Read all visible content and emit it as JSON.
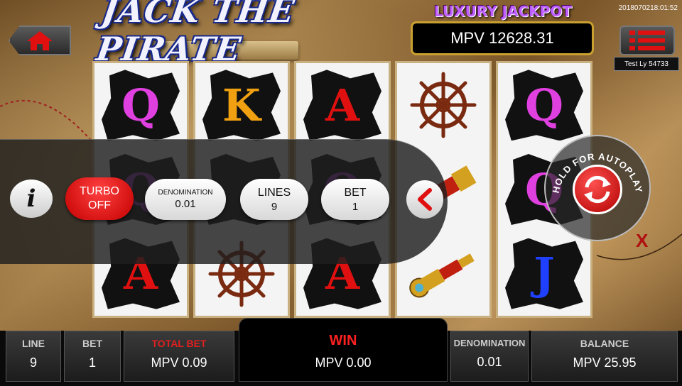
{
  "header": {
    "logo_text": "JACK THE PIRATE",
    "jackpot_title": "LUXURY JACKPOT",
    "jackpot_value": "MPV 12628.31",
    "timestamp": "2018070218:01:52",
    "user_label": "Test Ly 54733"
  },
  "reels": [
    {
      "symbols": [
        {
          "letter": "Q",
          "color": "#e040e0"
        },
        {
          "letter": "Q",
          "color": "#9a40c0"
        },
        {
          "letter": "A",
          "color": "#e01010"
        }
      ]
    },
    {
      "symbols": [
        {
          "letter": "K",
          "color": "#f0a010"
        },
        {
          "letter": "",
          "color": ""
        },
        {
          "icon": "ship-wheel-icon"
        }
      ]
    },
    {
      "symbols": [
        {
          "letter": "A",
          "color": "#e01010"
        },
        {
          "letter": "Q",
          "color": "#9a40c0"
        },
        {
          "letter": "A",
          "color": "#e01010"
        }
      ]
    },
    {
      "symbols": [
        {
          "icon": "ship-wheel-icon"
        },
        {
          "icon": "spyglass-icon"
        },
        {
          "icon": "spyglass-icon"
        }
      ]
    },
    {
      "symbols": [
        {
          "letter": "Q",
          "color": "#e040e0"
        },
        {
          "letter": "Q",
          "color": "#e040e0"
        },
        {
          "letter": "J",
          "color": "#2040ff"
        }
      ]
    }
  ],
  "controls": {
    "turbo_line1": "TURBO",
    "turbo_line2": "OFF",
    "denomination_label": "DENOMINATION",
    "denomination_value": "0.01",
    "lines_label": "LINES",
    "lines_value": "9",
    "bet_label": "BET",
    "bet_value": "1",
    "autoplay_text": "HOLD FOR AUTOPLAY"
  },
  "bottom": {
    "line_label": "LINE",
    "line_value": "9",
    "bet_label": "BET",
    "bet_value": "1",
    "total_bet_label": "TOTAL BET",
    "total_bet_value": "MPV 0.09",
    "win_label": "WIN",
    "win_value": "MPV 0.00",
    "denomination_label": "DENOMINATION",
    "denomination_value": "0.01",
    "balance_label": "BALANCE",
    "balance_value": "MPV 25.95"
  },
  "colors": {
    "accent_red": "#e01010",
    "jackpot_border": "#c9a030",
    "jackpot_title": "#c060ff"
  }
}
